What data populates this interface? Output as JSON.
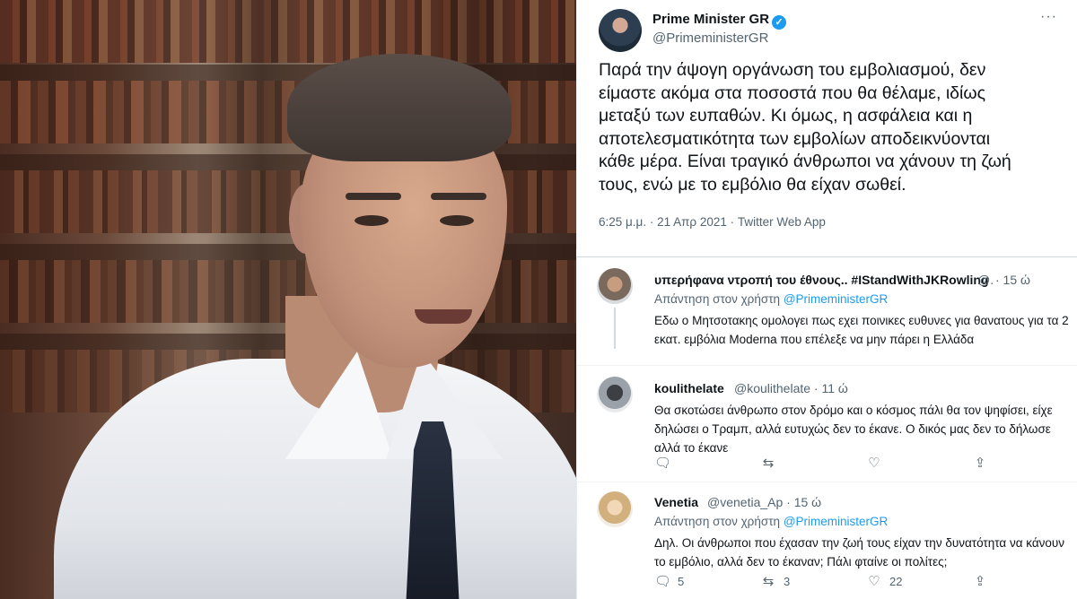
{
  "main_tweet": {
    "author_name": "Prime Minister GR",
    "verified_glyph": "✓",
    "author_handle": "@PrimeministerGR",
    "more_glyph": "···",
    "text": "Παρά την άψογη οργάνωση του εμβολιασμού, δεν\nείμαστε ακόμα στα ποσοστά που θα θέλαμε, ιδίως\nμεταξύ των ευπαθών. Κι όμως, η ασφάλεια και η\nαποτελεσματικότητα των εμβολίων αποδεικνύονται\nκάθε μέρα. Είναι τραγικό άνθρωποι να χάνουν τη ζωή\nτους, ενώ με το εμβόλιο θα είχαν σωθεί.",
    "meta": "6:25 μ.μ. · 21 Απρ 2021 · Twitter Web App"
  },
  "replies": [
    {
      "name": "υπερήφανα ντροπή του έθνους.. #IStandWithJKRowling",
      "handle": "@.",
      "time": "· 15 ώ",
      "reply_prefix": "Απάντηση στον χρήστη",
      "reply_to": "@PrimeministerGR",
      "text": "Εδω ο Μητσοτακης ομολογει πως εχει ποινικες ευθυνες για θανατους για τα 2 εκατ. εμβόλια Moderna που επέλεξε να μην πάρει η Ελλάδα"
    },
    {
      "name": "koulithelate",
      "handle": "@koulithelate · 11 ώ",
      "text": "Θα σκοτώσει άνθρωπο στον δρόμο και ο κόσμος πάλι θα τον ψηφίσει, είχε δηλώσει ο Τραμπ, αλλά ευτυχώς δεν το έκανε. Ο δικός μας δεν το δήλωσε αλλά το έκανε",
      "actions": {
        "reply": "",
        "retweet": "",
        "like": "",
        "share": ""
      }
    },
    {
      "name": "Venetia",
      "handle": "@venetia_Ap · 15 ώ",
      "reply_prefix": "Απάντηση στον χρήστη",
      "reply_to": "@PrimeministerGR",
      "text": "Δηλ. Οι άνθρωποι που έχασαν την ζωή τους είχαν την δυνατότητα να κάνουν το εμβόλιο, αλλά δεν το έκαναν; Πάλι φταίνε οι πολίτες;",
      "actions": {
        "reply": "5",
        "retweet": "3",
        "like": "22",
        "share": ""
      }
    }
  ],
  "icons": {
    "reply": "🗨",
    "retweet": "⇆",
    "like": "♡",
    "share": "⇪"
  },
  "colors": {
    "accent": "#1d9bf0",
    "muted": "#536471",
    "text": "#0f1419"
  }
}
